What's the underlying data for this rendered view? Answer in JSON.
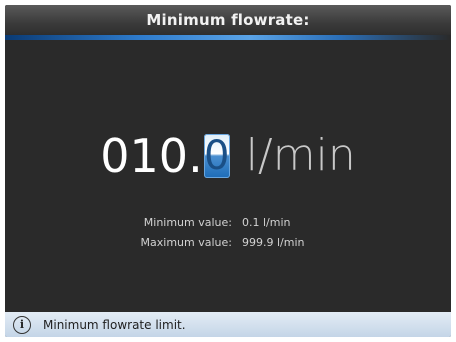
{
  "header": {
    "title": "Minimum flowrate:"
  },
  "editor": {
    "value_prefix": "010.",
    "value_cursor_digit": "0",
    "unit": "l/min"
  },
  "limits": {
    "min_label": "Minimum value:",
    "min_value": "0.1 l/min",
    "max_label": "Maximum value:",
    "max_value": "999.9 l/min"
  },
  "status": {
    "icon": "info-icon",
    "message": "Minimum flowrate limit."
  },
  "colors": {
    "accent": "#2e7bcc",
    "background": "#2a2a2a",
    "status_bg": "#d4e1ee"
  }
}
